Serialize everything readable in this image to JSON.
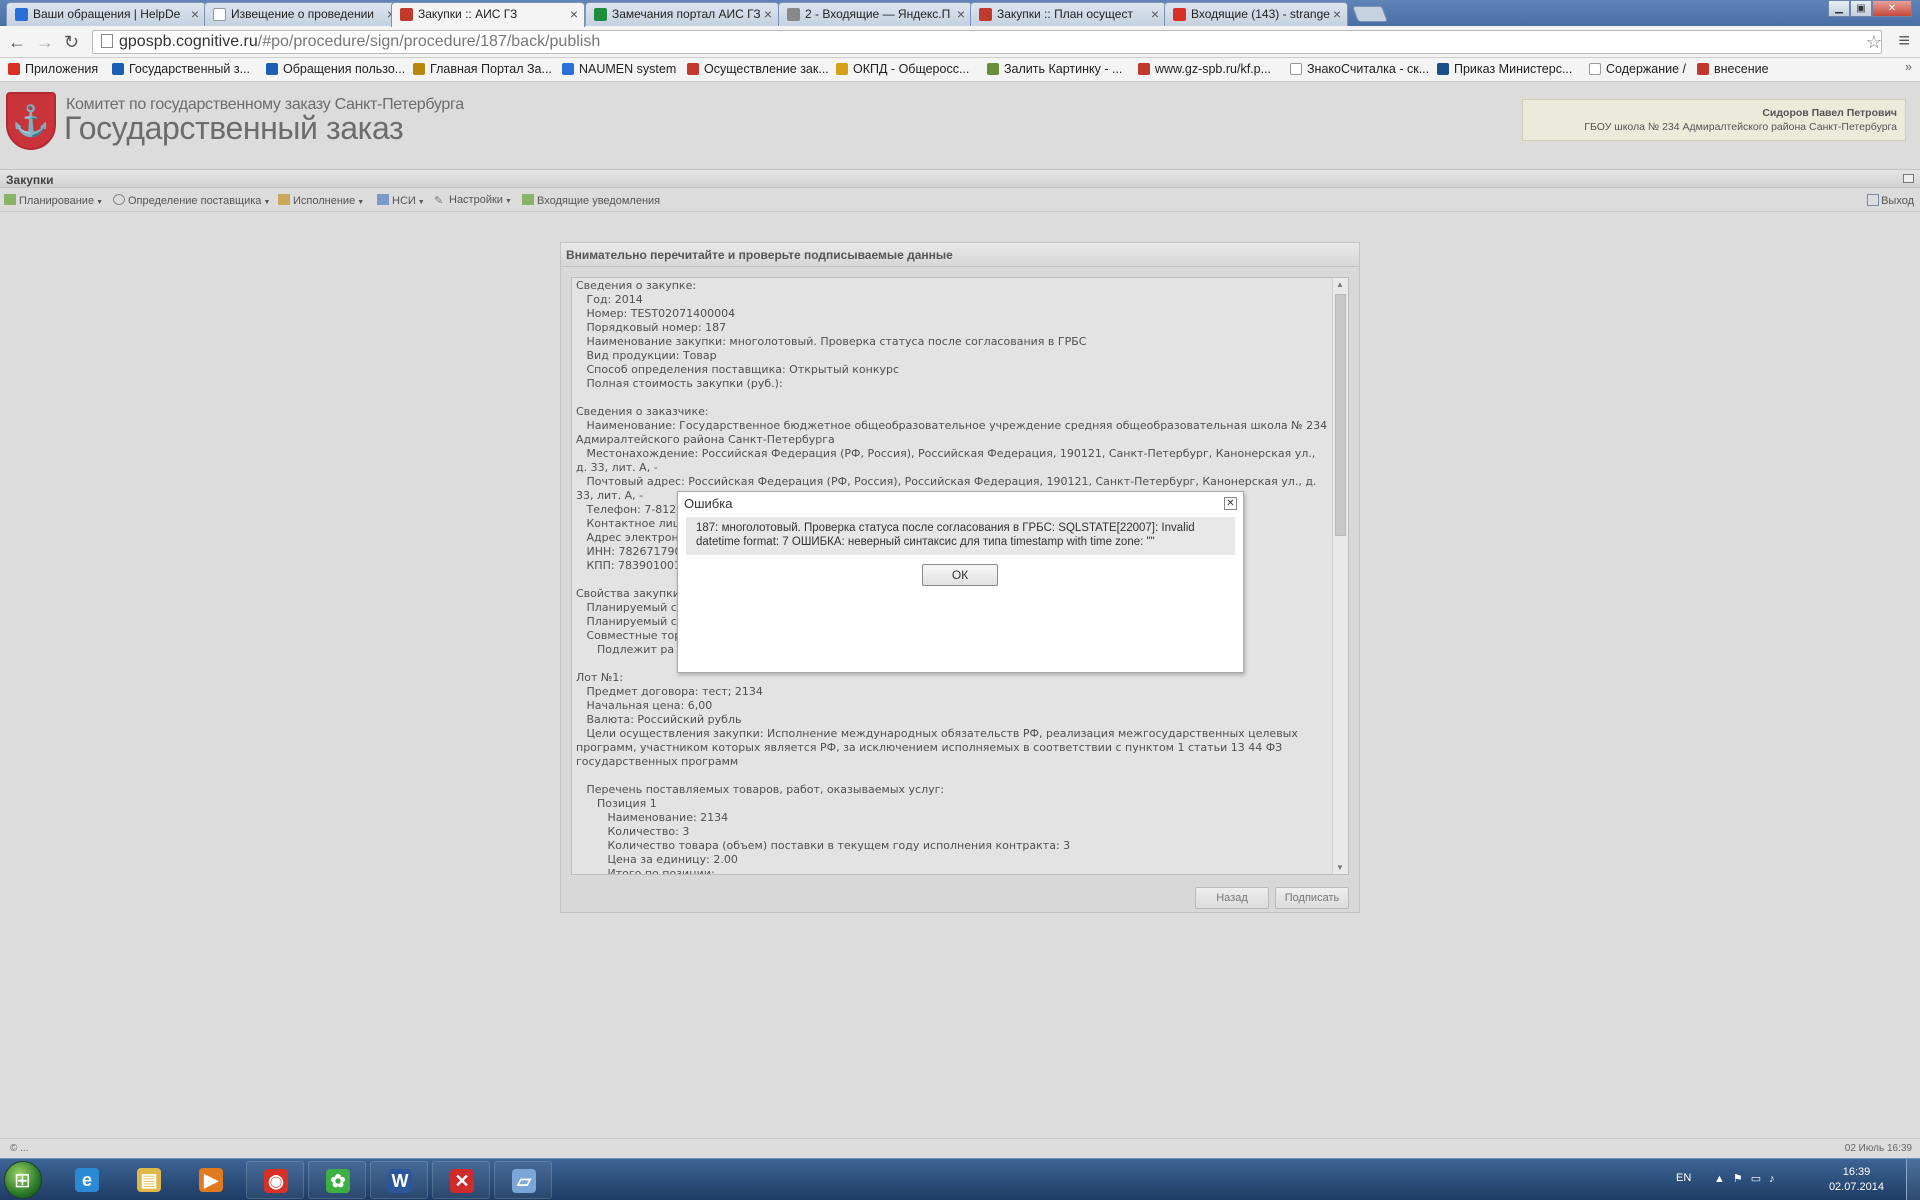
{
  "browser": {
    "tabs": [
      {
        "label": "Ваши обращения | HelpDe",
        "favicon_color": "#2a6fd6"
      },
      {
        "label": "Извещение о проведении",
        "favicon_color": "#ffffff"
      },
      {
        "label": "Закупки :: АИС ГЗ",
        "favicon_color": "#c0392b"
      },
      {
        "label": "Замечания портал АИС ГЗ",
        "favicon_color": "#1e8e3e"
      },
      {
        "label": "2 - Входящие — Яндекс.П",
        "favicon_color": "#888888"
      },
      {
        "label": "Закупки :: План осущест",
        "favicon_color": "#c0392b"
      },
      {
        "label": "Входящие (143) - strange",
        "favicon_color": "#d93025"
      }
    ],
    "url_host": "gpospb.cognitive.ru",
    "url_path": "/#po/procedure/sign/procedure/187/back/publish",
    "bookmarks": [
      {
        "label": "Приложения",
        "color": "#d93025"
      },
      {
        "label": "Государственный з...",
        "color": "#1a5fb4"
      },
      {
        "label": "Обращения пользо...",
        "color": "#1a5fb4"
      },
      {
        "label": "Главная Портал За...",
        "color": "#b8860b"
      },
      {
        "label": "NAUMEN system",
        "color": "#2a6fd6"
      },
      {
        "label": "Осуществление зак...",
        "color": "#c0392b"
      },
      {
        "label": "ОКПД - Общеросс...",
        "color": "#d4a017"
      },
      {
        "label": "Залить Картинку - ...",
        "color": "#6a8f3a"
      },
      {
        "label": "www.gz-spb.ru/kf.p...",
        "color": "#c0392b"
      },
      {
        "label": "ЗнакоСчиталка - ск...",
        "color": "#ffffff"
      },
      {
        "label": "Приказ Министерс...",
        "color": "#1a4f8a"
      },
      {
        "label": "Содержание /",
        "color": "#ffffff"
      },
      {
        "label": "внесение",
        "color": "#c0392b"
      }
    ]
  },
  "header": {
    "org_small": "Комитет по государственному заказу Санкт-Петербурга",
    "org_big": "Государственный заказ",
    "user_name": "Сидоров Павел Петрович",
    "user_org": "ГБОУ школа № 234 Адмиралтейского района Санкт-Петербурга"
  },
  "panel": {
    "title": "Закупки",
    "menu": [
      "Планирование",
      "Определение поставщика",
      "Исполнение",
      "НСИ",
      "Настройки",
      "Входящие уведомления"
    ],
    "logout": "Выход"
  },
  "sign": {
    "title": "Внимательно перечитайте и проверьте подписываемые данные",
    "document": "Сведения о закупке:\n   Год: 2014\n   Номер: TEST02071400004\n   Порядковый номер: 187\n   Наименование закупки: многолотовый. Проверка статуса после согласования в ГРБС\n   Вид продукции: Товар\n   Способ определения поставщика: Открытый конкурс\n   Полная стоимость закупки (руб.):\n\nСведения о заказчике:\n   Наименование: Государственное бюджетное общеобразовательное учреждение средняя общеобразовательная школа № 234 Адмиралтейского района Санкт-Петербурга\n   Местонахождение: Российская Федерация (РФ, Россия), Российская Федерация, 190121, Санкт-Петербург, Канонерская ул., д. 33, лит. А, -\n   Почтовый адрес: Российская Федерация (РФ, Россия), Российская Федерация, 190121, Санкт-Петербург, Канонерская ул., д. 33, лит. А, -\n   Телефон: 7-812-2761045\n   Контактное лицо: Сидоров Павел Петрович\n   Адрес электронной почты: konkurs206@mail.ru\n   ИНН: 7826717901\n   КПП: 783901001\n\nСвойства закупки:\n   Планируемый ср\n   Планируемый ср\n   Совместные тор\n      Подлежит ра\n\nЛот №1:\n   Предмет договора: тест; 2134\n   Начальная цена: 6,00\n   Валюта: Российский рубль\n   Цели осуществления закупки: Исполнение международных обязательств РФ, реализация межгосударственных целевых программ, участником которых является РФ, за исключением исполняемых в соответствии с пунктом 1 статьи 13 44 ФЗ государственных программ\n\n   Перечень поставляемых товаров, работ, оказываемых услуг:\n      Позиция 1\n         Наименование: 2134\n         Количество: 3\n         Количество товара (объем) поставки в текущем году исполнения контракта: 3\n         Цена за единицу: 2.00\n         Итого по позиции:",
    "back_label": "Назад",
    "sign_label": "Подписать"
  },
  "modal": {
    "title": "Ошибка",
    "close_glyph": "✕",
    "message": "187: многолотовый. Проверка статуса после согласования в ГРБС: SQLSTATE[22007]: Invalid datetime format: 7 ОШИБКА: неверный синтаксис для типа timestamp with time zone: \"\"",
    "ok_label": "ОК"
  },
  "footer": {
    "left": "© ...",
    "right": "02 Июль 16:39"
  },
  "taskbar": {
    "apps": [
      {
        "name": "internet-explorer",
        "glyph": "e",
        "color": "#2a8ad4"
      },
      {
        "name": "file-explorer",
        "glyph": "▤",
        "color": "#e0b84a"
      },
      {
        "name": "media-player",
        "glyph": "▶",
        "color": "#e07a20"
      },
      {
        "name": "chrome",
        "glyph": "◉",
        "color": "#d93025"
      },
      {
        "name": "icq",
        "glyph": "✿",
        "color": "#3cb043"
      },
      {
        "name": "word",
        "glyph": "W",
        "color": "#2b579a"
      },
      {
        "name": "x-app",
        "glyph": "✕",
        "color": "#d02b2b"
      },
      {
        "name": "notes-app",
        "glyph": "▱",
        "color": "#7aa6d8"
      }
    ],
    "lang": "EN",
    "time": "16:39",
    "date": "02.07.2014"
  }
}
